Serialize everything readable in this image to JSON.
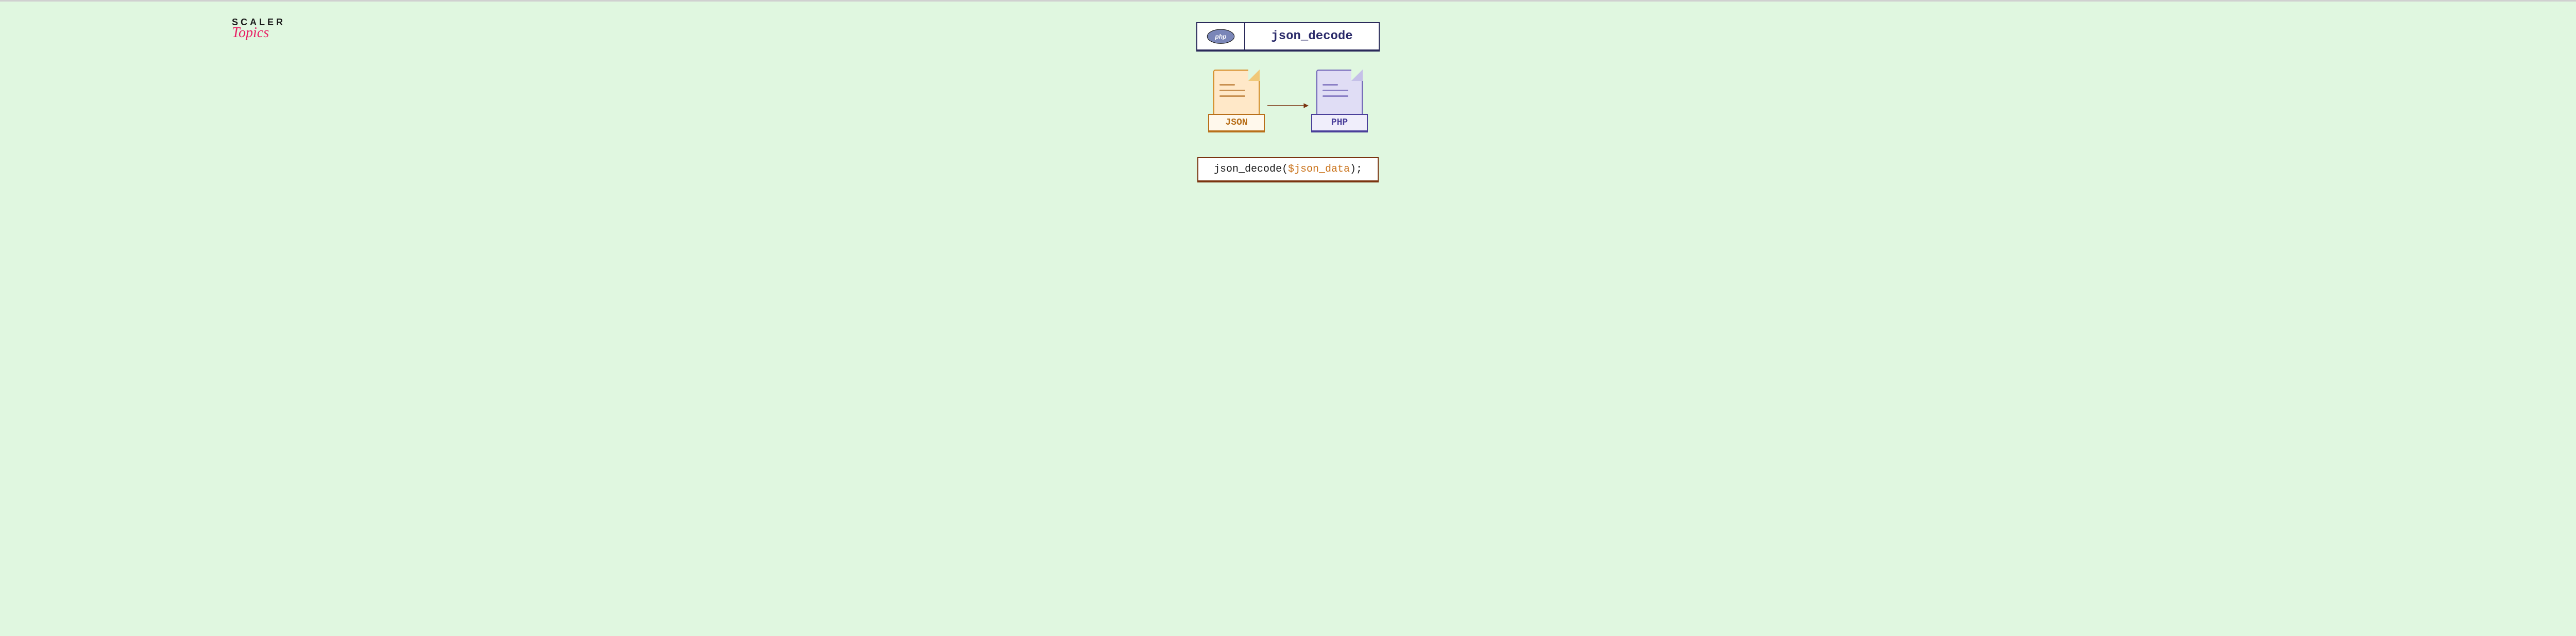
{
  "logo": {
    "line1": "SCALER",
    "line2": "Topics"
  },
  "header": {
    "badge": "php",
    "title": "json_decode"
  },
  "diagram": {
    "source_label": "JSON",
    "target_label": "PHP"
  },
  "code": {
    "function": "json_decode",
    "open": "(",
    "variable": "$json_data",
    "close": ");"
  },
  "colors": {
    "bg": "#e0f7e0",
    "json_accent": "#d48820",
    "json_fill": "#ffe8c8",
    "php_accent": "#6b5fb5",
    "php_fill": "#e0ddf5",
    "code_border": "#7a3410",
    "header_border": "#2a2a5a",
    "logo_pink": "#e91e63"
  }
}
